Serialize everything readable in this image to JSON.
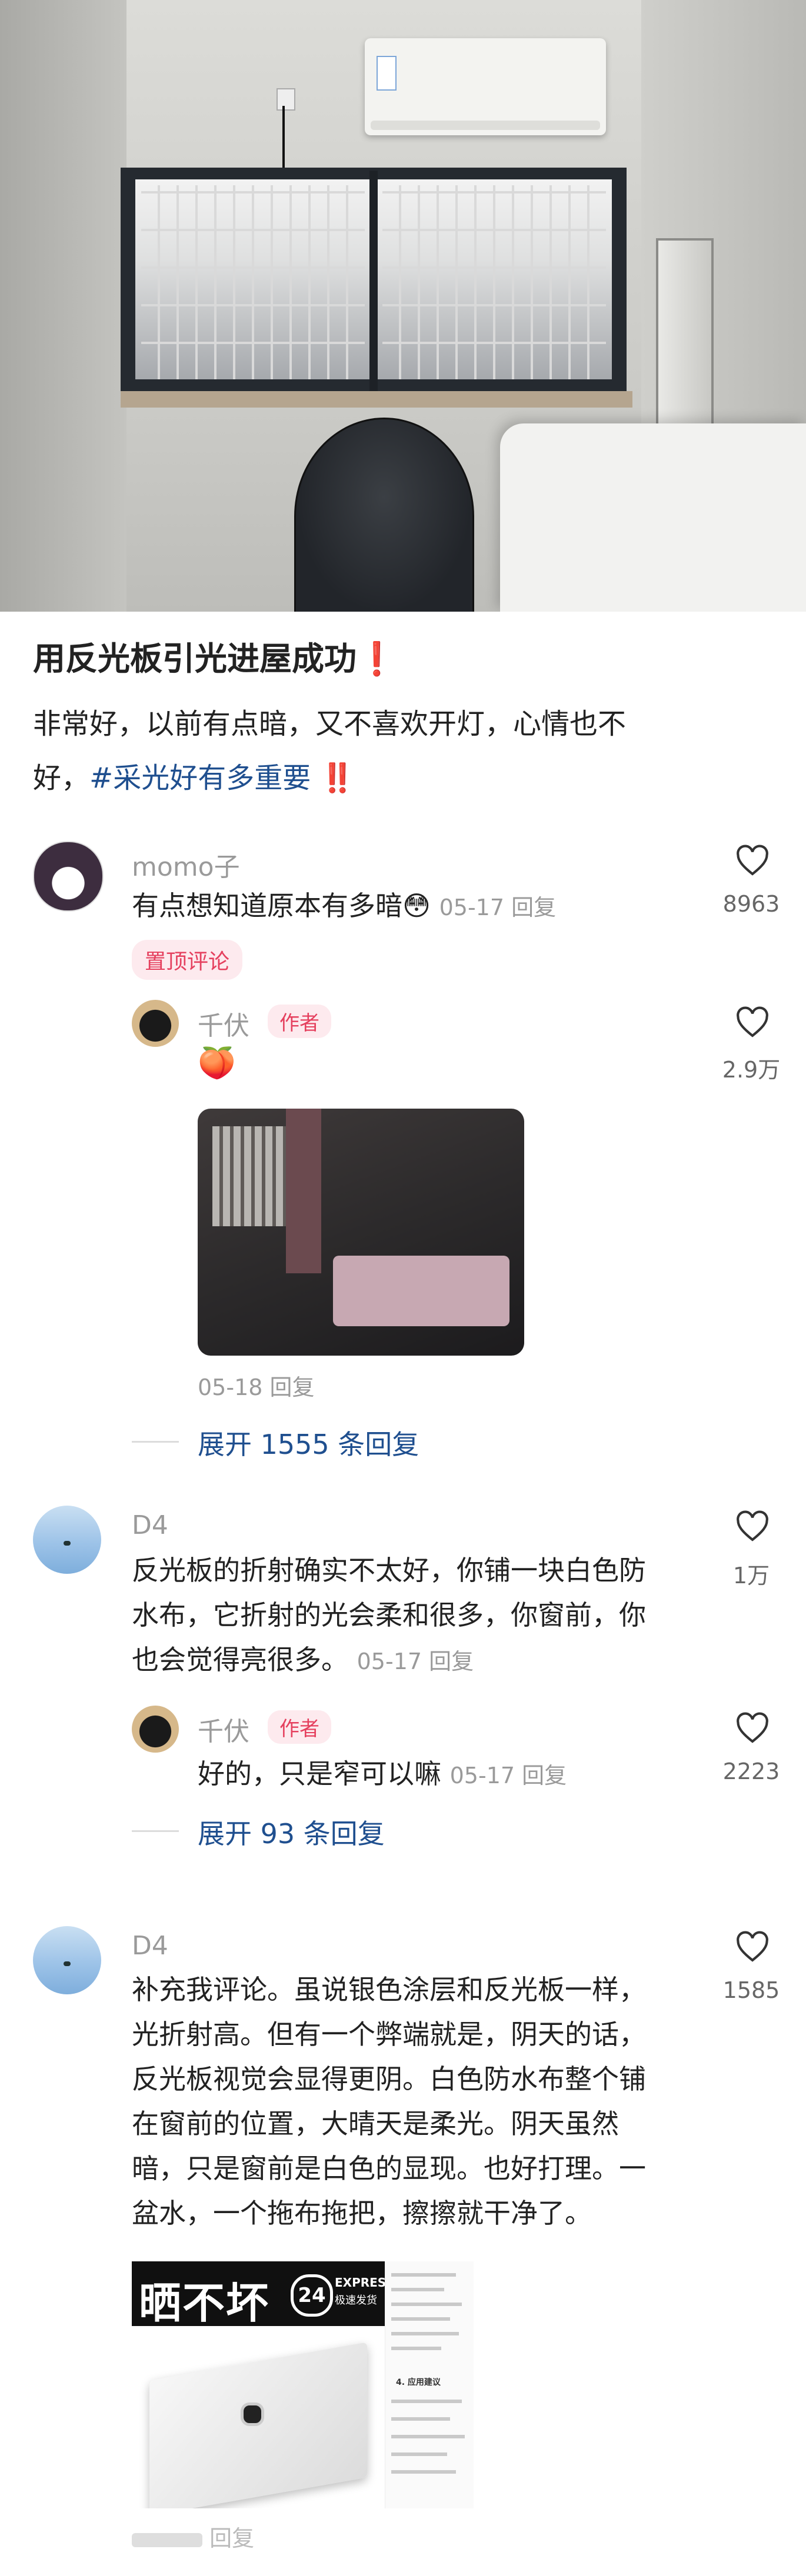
{
  "post": {
    "title": "用反光板引光进屋成功",
    "title_emoji": "❗",
    "body_line1": "非常好，以前有点暗，又不喜欢开灯，心情也不",
    "body_line2_start": "好，",
    "hashtag": "#采光好有多重要",
    "hashtag_emoji": "‼️"
  },
  "comments": [
    {
      "name": "momo子",
      "text": "有点想知道原本有多暗😳",
      "meta": "05-17 回复",
      "likes": "8963",
      "pin_label": "置顶评论",
      "reply": {
        "name": "千伏",
        "author_tag": "作者",
        "text": "🍑",
        "meta": "05-18 回复",
        "likes": "2.9万"
      },
      "expand": "展开 1555 条回复"
    },
    {
      "name": "D4",
      "line1": "反光板的折射确实不太好，你铺一块白色防",
      "line2": "水布，它折射的光会柔和很多，你窗前，你",
      "line3": "也会觉得亮很多。",
      "meta": "05-17 回复",
      "likes": "1万",
      "reply": {
        "name": "千伏",
        "author_tag": "作者",
        "text": "好的，只是窄可以嘛",
        "meta": "05-17 回复",
        "likes": "2223"
      },
      "expand": "展开 93 条回复"
    },
    {
      "name": "D4",
      "lines": [
        "补充我评论。虽说银色涂层和反光板一样，",
        "光折射高。但有一个弊端就是，阴天的话，",
        "反光板视觉会显得更阴。白色防水布整个铺",
        "在窗前的位置，大晴天是柔光。阴天虽然",
        "暗，只是窗前是白色的显现。也好打理。一",
        "盆水，一个拖布拖把，擦擦就干净了。"
      ],
      "likes": "1585",
      "product_image_text": "晒不坏",
      "product_badge": "24",
      "product_express": "EXPRESS",
      "product_sub": "极速发货",
      "doc_section": "4. 应用建议",
      "meta_partial": "回复"
    }
  ],
  "colors": {
    "accent_pink": "#e5405e",
    "link_blue": "#1f4f8f",
    "muted": "#9a9a9a"
  },
  "icons": {
    "like": "heart-outline-icon"
  }
}
